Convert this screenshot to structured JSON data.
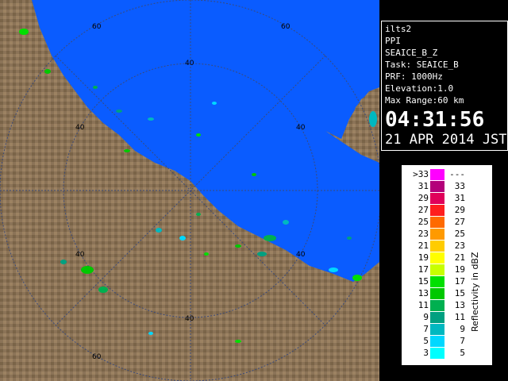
{
  "info": {
    "lines": [
      "ilts2",
      "PPI",
      "SEAICE_B_Z",
      "Task: SEAICE_B",
      "PRF: 1000Hz",
      "Elevation:1.0",
      "Max Range:60 km"
    ],
    "time": "04:31:56",
    "date": "21 APR 2014 JST"
  },
  "map": {
    "range_labels": [
      "60",
      "60",
      "40",
      "40",
      "40",
      "40",
      "40",
      "40",
      "60"
    ],
    "colors": {
      "sea": "#0a5cff",
      "land": "#8b7357",
      "rings": "#3a4a7a"
    }
  },
  "legend": {
    "unit": "Reflectivity in dBZ",
    "rows": [
      {
        "left": ">33",
        "right": "---",
        "color": "#ff00ff"
      },
      {
        "left": "31",
        "right": "33",
        "color": "#b4007a"
      },
      {
        "left": "29",
        "right": "31",
        "color": "#e0005a"
      },
      {
        "left": "27",
        "right": "29",
        "color": "#ff1e1e"
      },
      {
        "left": "25",
        "right": "27",
        "color": "#ff6a00"
      },
      {
        "left": "23",
        "right": "25",
        "color": "#ff9a00"
      },
      {
        "left": "21",
        "right": "23",
        "color": "#ffcc00"
      },
      {
        "left": "19",
        "right": "21",
        "color": "#ffff00"
      },
      {
        "left": "17",
        "right": "19",
        "color": "#c8ff00"
      },
      {
        "left": "15",
        "right": "17",
        "color": "#00e000"
      },
      {
        "left": "13",
        "right": "15",
        "color": "#00c800"
      },
      {
        "left": "11",
        "right": "13",
        "color": "#00b050"
      },
      {
        "left": "9",
        "right": "11",
        "color": "#00a080"
      },
      {
        "left": "7",
        "right": "9",
        "color": "#00b8c0"
      },
      {
        "left": "5",
        "right": "7",
        "color": "#00d8ff"
      },
      {
        "left": "3",
        "right": "5",
        "color": "#00ffff"
      }
    ]
  }
}
